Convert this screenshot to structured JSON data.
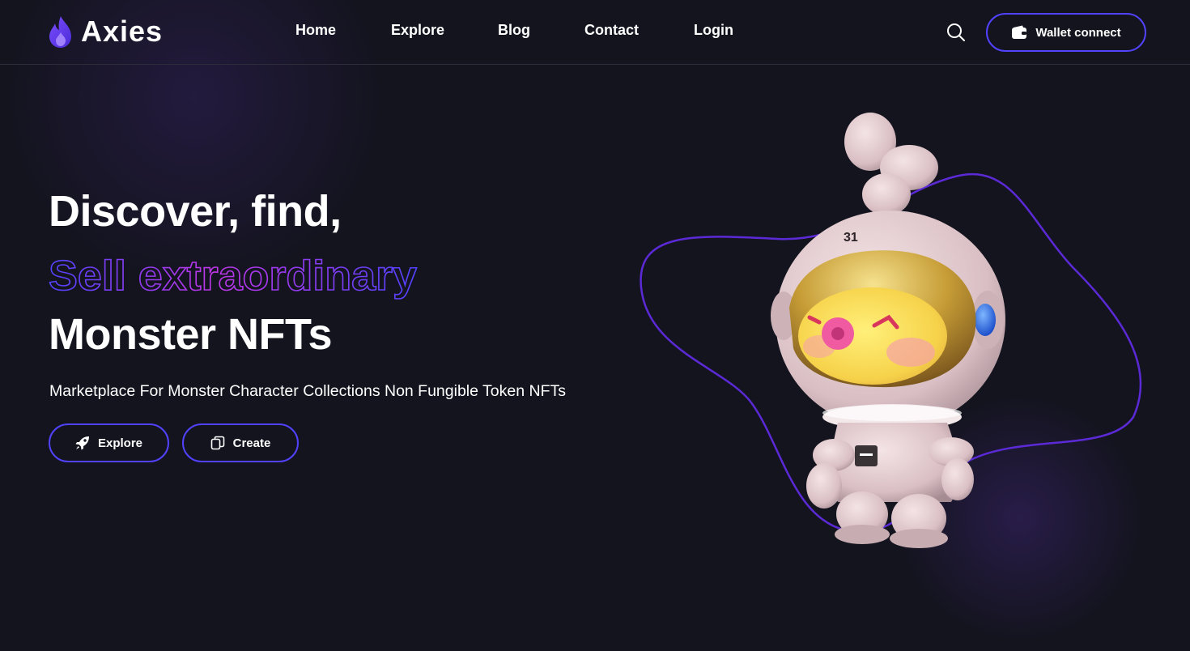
{
  "brand": {
    "name": "Axies",
    "accent": "#5142fc",
    "accent2": "#bf36e8",
    "background": "#14141f"
  },
  "nav": {
    "items": [
      {
        "label": "Home"
      },
      {
        "label": "Explore"
      },
      {
        "label": "Blog"
      },
      {
        "label": "Contact"
      },
      {
        "label": "Login"
      }
    ],
    "search_icon": "search-icon",
    "wallet_label": "Wallet connect",
    "wallet_icon": "wallet-icon"
  },
  "hero": {
    "line1": "Discover, find,",
    "line2": "Sell extraordinary",
    "line3": "Monster NFTs",
    "subtitle": "Marketplace For Monster Character Collections Non Fungible Token NFTs",
    "buttons": [
      {
        "label": "Explore",
        "icon": "rocket-icon"
      },
      {
        "label": "Create",
        "icon": "copy-icon"
      }
    ],
    "art": {
      "helmet_number": "31",
      "icon": "astronaut-monster-illustration"
    }
  }
}
